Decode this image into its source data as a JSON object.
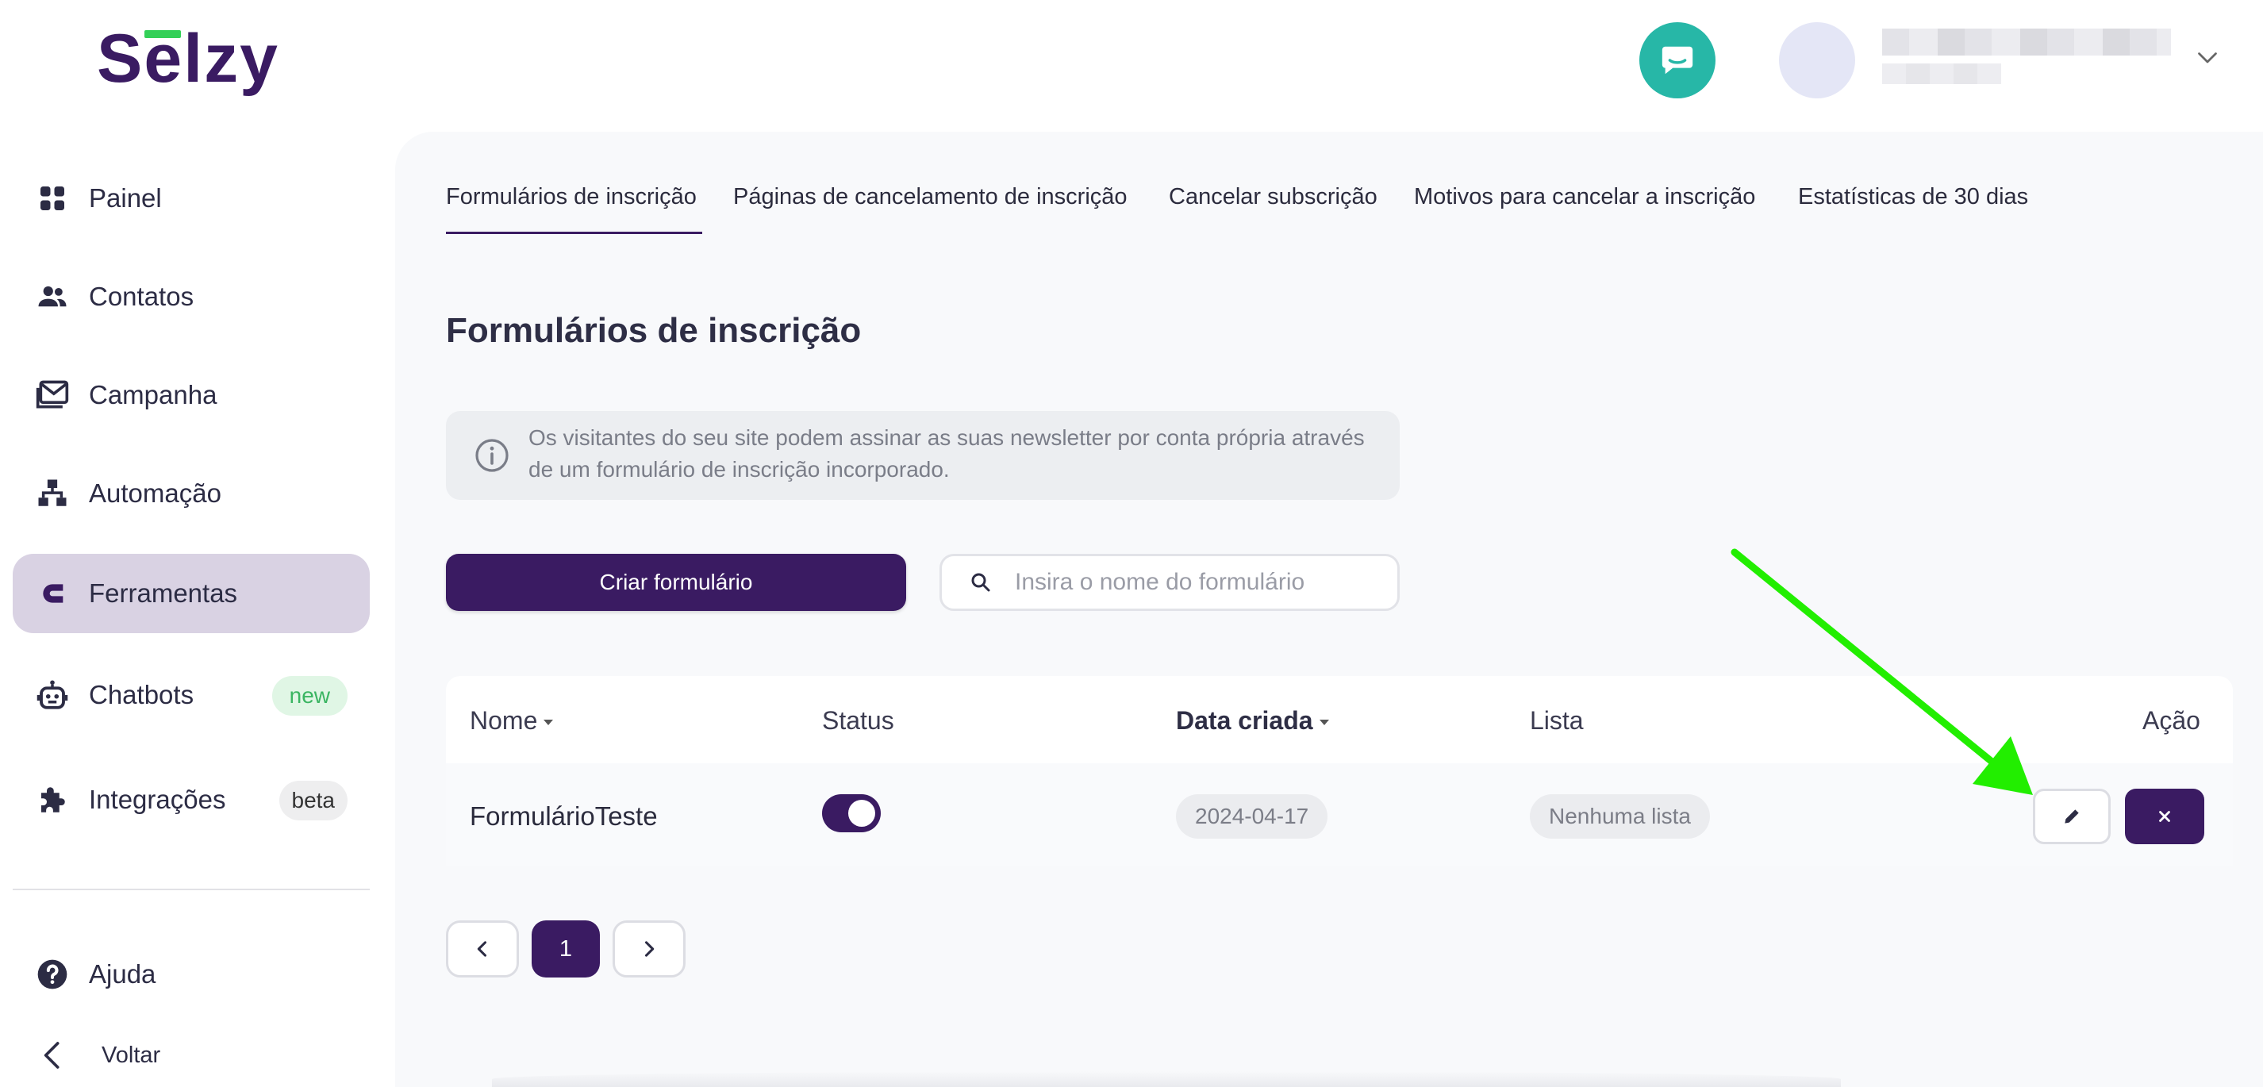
{
  "brand": {
    "logo_text": "Selzy",
    "accent_color": "#3a1b62",
    "chat_color": "#27b7a7",
    "arrow_color": "#22ee00"
  },
  "header": {
    "chat_icon": "chat-bubble-icon",
    "account_chevron_icon": "chevron-down-icon"
  },
  "sidebar": {
    "items": [
      {
        "label": "Painel",
        "icon": "grid-icon"
      },
      {
        "label": "Contatos",
        "icon": "users-icon"
      },
      {
        "label": "Campanha",
        "icon": "envelope-icon"
      },
      {
        "label": "Automação",
        "icon": "hierarchy-icon"
      },
      {
        "label": "Ferramentas",
        "icon": "magnet-icon",
        "active": true
      },
      {
        "label": "Chatbots",
        "icon": "robot-icon",
        "badge": "new"
      },
      {
        "label": "Integrações",
        "icon": "puzzle-icon",
        "badge": "beta"
      }
    ],
    "help_label": "Ajuda",
    "back_label": "Voltar"
  },
  "tabs": [
    {
      "label": "Formulários de inscrição",
      "active": true
    },
    {
      "label": "Páginas de cancelamento de inscrição"
    },
    {
      "label": "Cancelar subscrição"
    },
    {
      "label": "Motivos para cancelar a inscrição"
    },
    {
      "label": "Estatísticas de 30 dias"
    }
  ],
  "page": {
    "title": "Formulários de inscrição",
    "info_text": "Os visitantes do seu site podem assinar as suas newsletter por conta própria através de um formulário de inscrição incorporado.",
    "create_button": "Criar formulário",
    "search_placeholder": "Insira o nome do formulário"
  },
  "table": {
    "columns": [
      "Nome",
      "Status",
      "Data criada",
      "Lista",
      "Ação"
    ],
    "rows": [
      {
        "name": "FormulárioTeste",
        "status_on": true,
        "created": "2024-04-17",
        "list": "Nenhuma lista"
      }
    ]
  },
  "pagination": {
    "current_page": "1"
  }
}
